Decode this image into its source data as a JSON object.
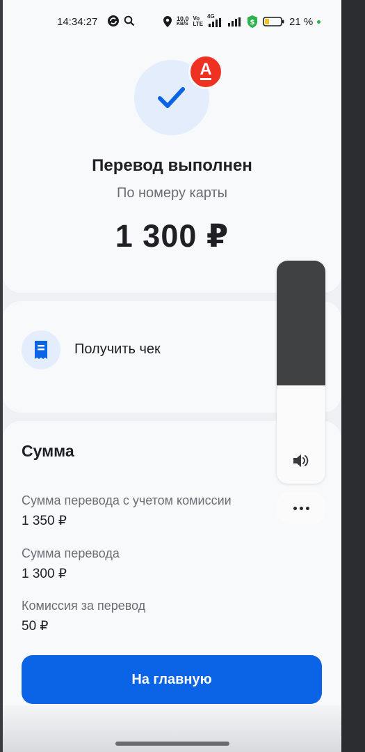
{
  "status_bar": {
    "time": "14:34:27",
    "net_speed_top": "10,0",
    "net_speed_bottom": "KB/S",
    "volte_top": "Vo",
    "volte_bottom": "LTE",
    "network": "4G",
    "battery": "21 %"
  },
  "result": {
    "bank_logo": "А",
    "title": "Перевод выполнен",
    "subtitle": "По номеру карты",
    "amount": "1 300 ₽"
  },
  "receipt": {
    "label": "Получить чек"
  },
  "summary": {
    "heading": "Сумма",
    "rows": [
      {
        "label": "Сумма перевода с учетом комиссии",
        "value": "1 350 ₽"
      },
      {
        "label": "Сумма перевода",
        "value": "1 300 ₽"
      },
      {
        "label": "Комиссия за перевод",
        "value": "50 ₽"
      }
    ]
  },
  "actions": {
    "home_button": "На главную"
  },
  "volume": {
    "level": 0.56
  },
  "colors": {
    "accent": "#0b63e5",
    "brand_red": "#ef3124",
    "status_green": "#2bb24c"
  }
}
